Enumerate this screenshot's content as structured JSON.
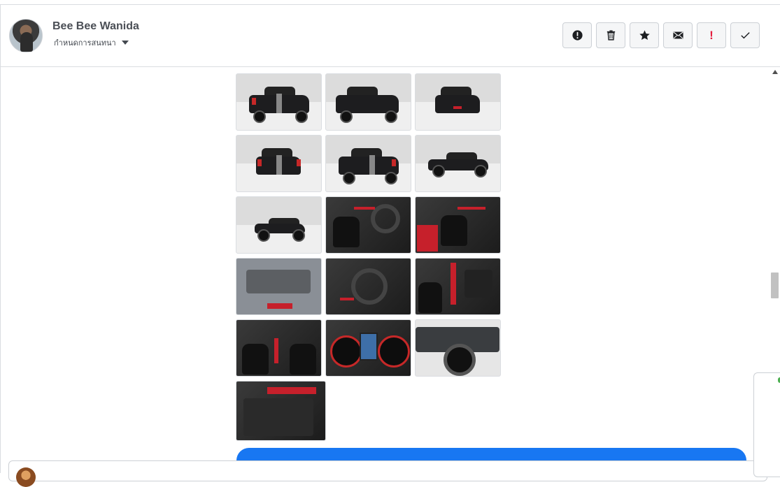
{
  "contact": {
    "name": "Bee Bee Wanida",
    "subtitle": "กำหนดการสนทนา"
  },
  "toolbar": {
    "buttons": [
      {
        "name": "report-button",
        "icon": "alert-circle-icon"
      },
      {
        "name": "delete-button",
        "icon": "trash-icon"
      },
      {
        "name": "star-button",
        "icon": "star-icon"
      },
      {
        "name": "mark-unread-button",
        "icon": "envelope-icon"
      },
      {
        "name": "spam-button",
        "icon": "exclamation-icon",
        "label": "!"
      },
      {
        "name": "done-button",
        "icon": "checkmark-icon"
      }
    ]
  },
  "gallery": {
    "photos": [
      {
        "id": "p1",
        "subject": "truck-rear-left"
      },
      {
        "id": "p2",
        "subject": "truck-front-left"
      },
      {
        "id": "p3",
        "subject": "truck-front"
      },
      {
        "id": "p4",
        "subject": "truck-rear"
      },
      {
        "id": "p5",
        "subject": "truck-rear-right"
      },
      {
        "id": "p6",
        "subject": "truck-side-right"
      },
      {
        "id": "p7",
        "subject": "truck-side-showroom"
      },
      {
        "id": "p8",
        "subject": "interior-driver-seat"
      },
      {
        "id": "p9",
        "subject": "interior-passenger-seat"
      },
      {
        "id": "p10",
        "subject": "engine-bay"
      },
      {
        "id": "p11",
        "subject": "steering-dashboard"
      },
      {
        "id": "p12",
        "subject": "gear-shifter"
      },
      {
        "id": "p13",
        "subject": "interior-rear-view"
      },
      {
        "id": "p14",
        "subject": "instrument-cluster"
      },
      {
        "id": "p15",
        "subject": "wheel-closeup"
      },
      {
        "id": "p16",
        "subject": "door-panel"
      }
    ]
  },
  "colors": {
    "accent_blue": "#1877f2",
    "red_trim": "#c6202b",
    "border": "#dadde1"
  }
}
